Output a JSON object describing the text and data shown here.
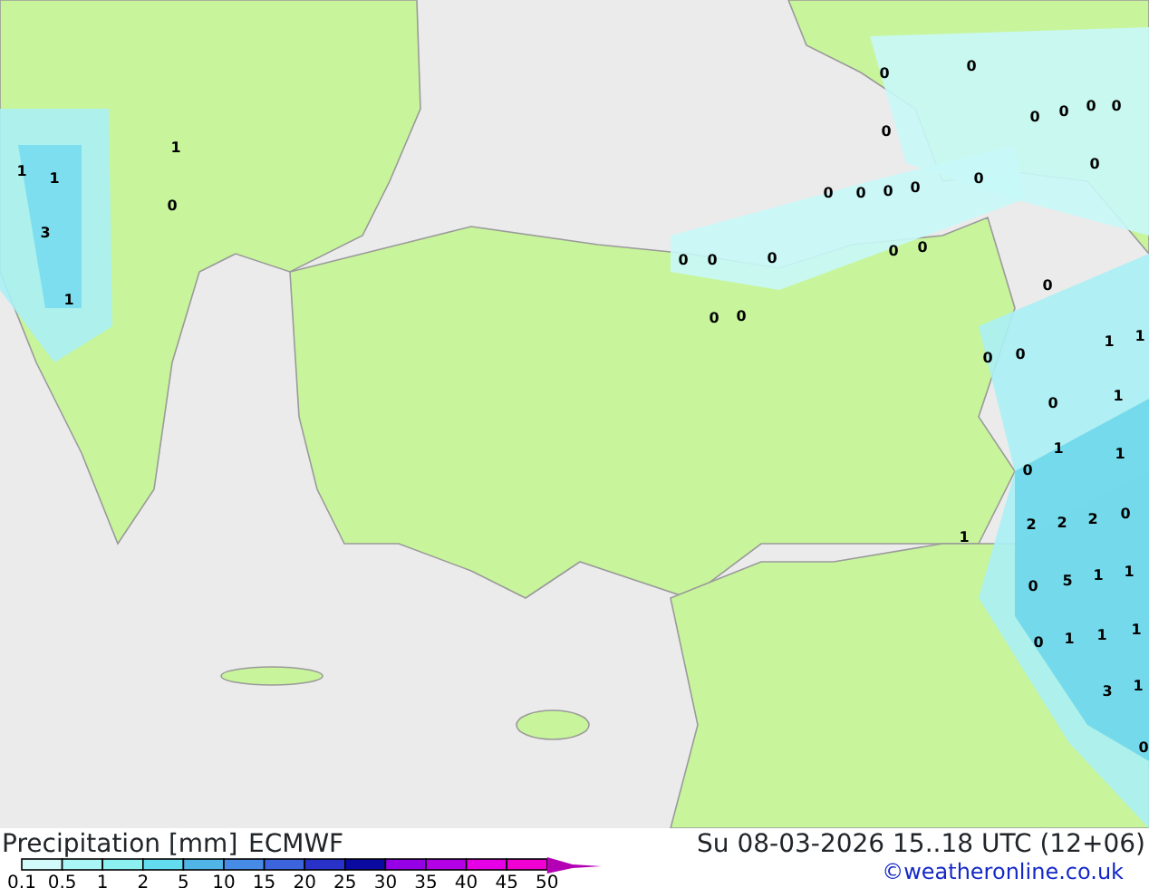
{
  "map": {
    "labels": [
      "1",
      "1",
      "1",
      "0",
      "3",
      "1",
      "0",
      "0",
      "0",
      "0",
      "0",
      "0",
      "0",
      "0",
      "0",
      "0",
      "0",
      "0",
      "0",
      "0",
      "0",
      "0",
      "0",
      "0",
      "0",
      "0",
      "0",
      "1",
      "1",
      "0",
      "0",
      "0",
      "1",
      "1",
      "0",
      "1",
      "2",
      "2",
      "2",
      "0",
      "1",
      "1",
      "1",
      "0",
      "5",
      "0",
      "1",
      "1",
      "1",
      "3",
      "1",
      "0"
    ]
  },
  "legend": {
    "title": "Precipitation [mm]",
    "model": "ECMWF",
    "swatches": [
      {
        "color": "#d2fafa"
      },
      {
        "color": "#aaf5f5"
      },
      {
        "color": "#8cf0f0"
      },
      {
        "color": "#64dcf0"
      },
      {
        "color": "#50b4e6"
      },
      {
        "color": "#468ce6"
      },
      {
        "color": "#3c64dc"
      },
      {
        "color": "#2832c8"
      },
      {
        "color": "#0a0aa0"
      },
      {
        "color": "#9600e6"
      },
      {
        "color": "#b400e6"
      },
      {
        "color": "#e600e6"
      },
      {
        "color": "#f000d2"
      },
      {
        "color": "#b400b4"
      }
    ],
    "ticks": [
      "0.1",
      "0.5",
      "1",
      "2",
      "5",
      "10",
      "15",
      "20",
      "25",
      "30",
      "35",
      "40",
      "45",
      "50"
    ]
  },
  "valid_time": "Su 08-03-2026 15..18 UTC (12+06)",
  "credit": "©weatheronline.co.uk"
}
